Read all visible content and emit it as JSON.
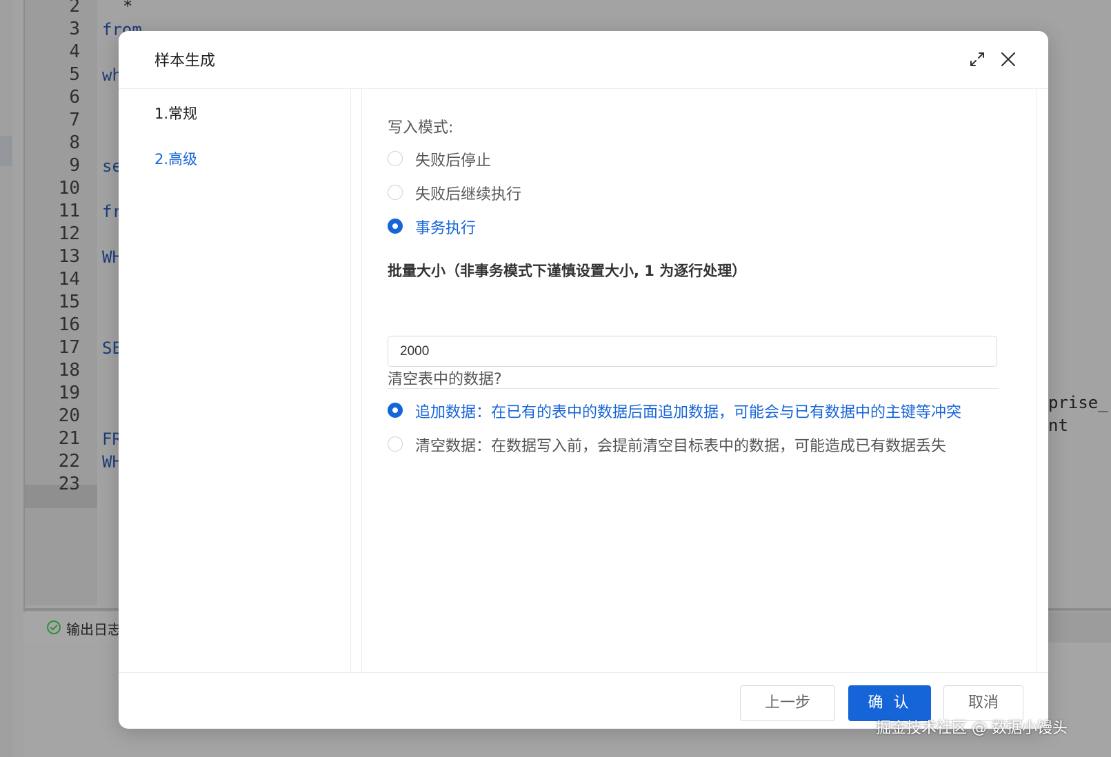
{
  "editor": {
    "line_numbers": [
      "2",
      "3",
      "4",
      "5",
      "6",
      "7",
      "8",
      "9",
      "10",
      "11",
      "12",
      "13",
      "14",
      "15",
      "16",
      "17",
      "18",
      "19",
      "20",
      "21",
      "22",
      "23"
    ],
    "code_fragments": {
      "line2": "*",
      "line3": "from",
      "line5": "wh",
      "line9": "se",
      "line11": "fr",
      "line13": "WH",
      "line17": "SE",
      "line21": "FR",
      "line22": "WH"
    },
    "right_fragments": [
      "prise_",
      "nt"
    ],
    "output_tab_label": "输出日志"
  },
  "modal": {
    "title": "样本生成",
    "icons": [
      "expand-icon",
      "close-icon"
    ],
    "steps": [
      {
        "label": "1.常规",
        "active": false
      },
      {
        "label": "2.高级",
        "active": true
      }
    ],
    "write_mode": {
      "label": "写入模式:",
      "options": [
        {
          "label": "失败后停止",
          "checked": false
        },
        {
          "label": "失败后继续执行",
          "checked": false
        },
        {
          "label": "事务执行",
          "checked": true
        }
      ]
    },
    "batch_size": {
      "label": "批量大小（非事务模式下谨慎设置大小, 1 为逐行处理）",
      "value": "2000"
    },
    "clear_table": {
      "label": "清空表中的数据?",
      "options": [
        {
          "label": "追加数据：在已有的表中的数据后面追加数据，可能会与已有数据中的主键等冲突",
          "checked": true
        },
        {
          "label": "清空数据：在数据写入前，会提前清空目标表中的数据，可能造成已有数据丢失",
          "checked": false
        }
      ]
    },
    "footer": {
      "prev_label": "上一步",
      "ok_label": "确 认",
      "cancel_label": "取消"
    }
  },
  "watermark": "掘金技术社区 @ 数据小馒头",
  "colors": {
    "accent": "#1665d8",
    "overlay": "#a3a3a3"
  }
}
